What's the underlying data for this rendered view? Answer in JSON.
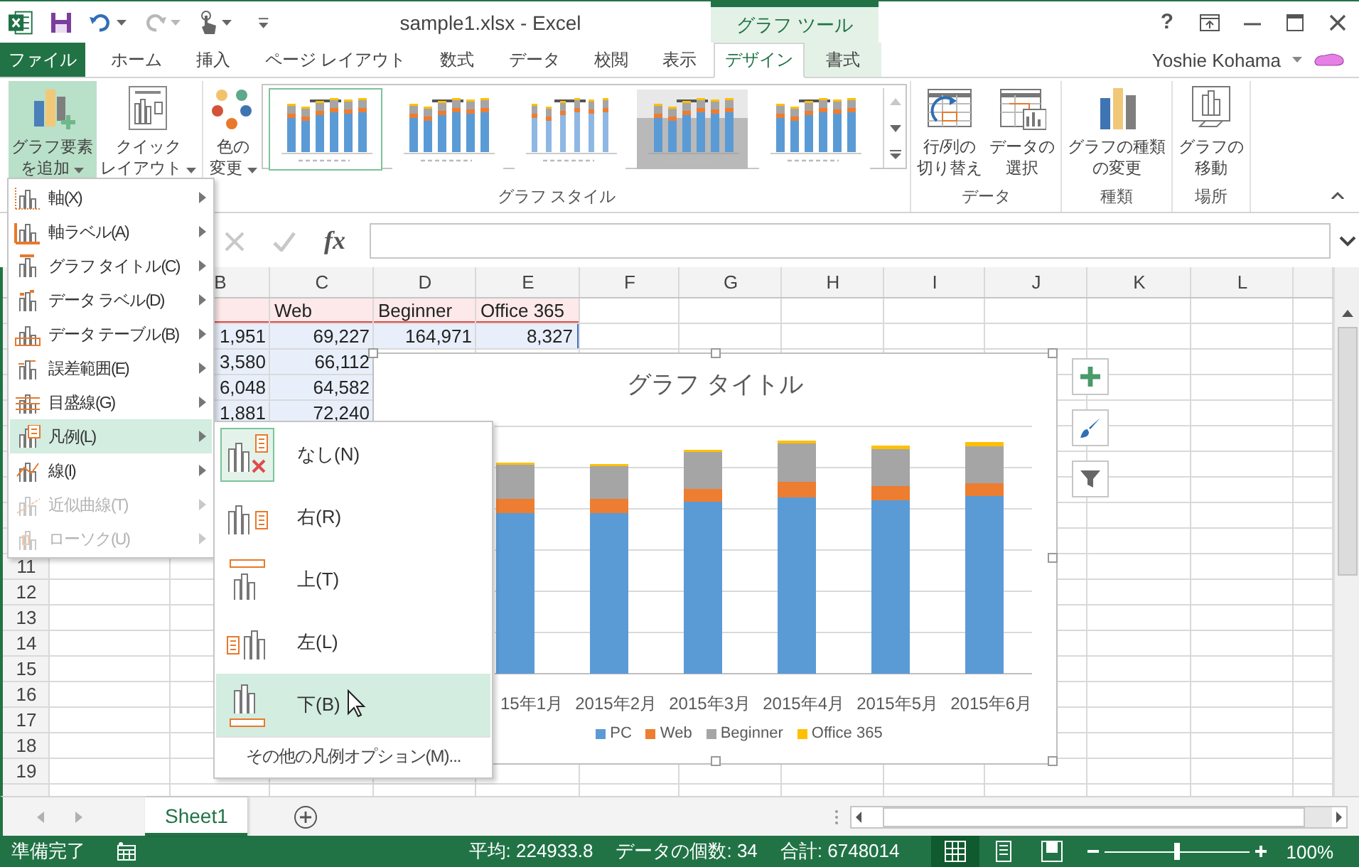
{
  "window": {
    "title": "sample1.xlsx - Excel",
    "contextual_group": "グラフ ツール",
    "help": "?",
    "user": "Yoshie Kohama"
  },
  "tabs": [
    {
      "label": "ファイル",
      "kind": "file",
      "selected": false
    },
    {
      "label": "ホーム",
      "kind": "normal",
      "selected": false
    },
    {
      "label": "挿入",
      "kind": "normal",
      "selected": false
    },
    {
      "label": "ページ レイアウト",
      "kind": "normal",
      "selected": false
    },
    {
      "label": "数式",
      "kind": "normal",
      "selected": false
    },
    {
      "label": "データ",
      "kind": "normal",
      "selected": false
    },
    {
      "label": "校閲",
      "kind": "normal",
      "selected": false
    },
    {
      "label": "表示",
      "kind": "normal",
      "selected": false
    },
    {
      "label": "デザイン",
      "kind": "contextual",
      "selected": true
    },
    {
      "label": "書式",
      "kind": "contextual",
      "selected": false
    }
  ],
  "ribbon": {
    "layout_buttons": [
      {
        "lines": [
          "グラフ要素",
          "を追加"
        ],
        "pressed": true
      },
      {
        "lines": [
          "クイック",
          "レイアウト"
        ],
        "pressed": false
      }
    ],
    "style_group": {
      "label": "グラフ スタイル",
      "color_button": {
        "lines": [
          "色の",
          "変更"
        ]
      },
      "styles": [
        {
          "selected": true
        },
        {
          "selected": false
        },
        {
          "selected": false
        },
        {
          "selected": false
        },
        {
          "selected": false
        }
      ]
    },
    "groups": [
      {
        "label": "データ",
        "buttons": [
          {
            "lines": [
              "行/列の",
              "切り替え"
            ]
          },
          {
            "lines": [
              "データの",
              "選択"
            ]
          }
        ]
      },
      {
        "label": "種類",
        "buttons": [
          {
            "lines": [
              "グラフの種類",
              "の変更"
            ]
          }
        ]
      },
      {
        "label": "場所",
        "buttons": [
          {
            "lines": [
              "グラフの",
              "移動"
            ]
          }
        ]
      }
    ]
  },
  "formula_bar": {
    "function_label": "fx"
  },
  "sheet": {
    "columns": [
      "B",
      "C",
      "D",
      "E",
      "F",
      "G",
      "H",
      "I",
      "J",
      "K",
      "L"
    ],
    "data_rows": [
      {
        "kind": "names",
        "cells": {
          "C": "Web",
          "D": "Beginner",
          "E": "Office 365"
        }
      },
      {
        "kind": "values",
        "cells": {
          "B": "1,951",
          "C": "69,227",
          "D": "164,971",
          "E": "8,327"
        }
      },
      {
        "kind": "values",
        "cells": {
          "B": "3,580",
          "C": "66,112"
        }
      },
      {
        "kind": "values",
        "cells": {
          "B": "6,048",
          "C": "64,582"
        }
      },
      {
        "kind": "values",
        "cells": {
          "B": "1,881",
          "C": "72,240"
        }
      }
    ],
    "row_numbers": [
      "11",
      "12",
      "13",
      "14",
      "15",
      "16",
      "17",
      "18",
      "19"
    ]
  },
  "chart": {
    "title": "グラフ タイトル",
    "x_labels": [
      "15年1月",
      "2015年2月",
      "2015年3月",
      "2015年4月",
      "2015年5月",
      "2015年6月"
    ],
    "legend": [
      {
        "name": "PC",
        "color": "#5b9bd5"
      },
      {
        "name": "Web",
        "color": "#ed7d31"
      },
      {
        "name": "Beginner",
        "color": "#a5a5a5"
      },
      {
        "name": "Office 365",
        "color": "#ffc000"
      }
    ]
  },
  "element_menu": [
    {
      "label": "軸(X)",
      "highlighted": false,
      "disabled": false
    },
    {
      "label": "軸ラベル(A)",
      "highlighted": false,
      "disabled": false
    },
    {
      "label": "グラフ タイトル(C)",
      "highlighted": false,
      "disabled": false
    },
    {
      "label": "データ ラベル(D)",
      "highlighted": false,
      "disabled": false
    },
    {
      "label": "データ テーブル(B)",
      "highlighted": false,
      "disabled": false
    },
    {
      "label": "誤差範囲(E)",
      "highlighted": false,
      "disabled": false
    },
    {
      "label": "目盛線(G)",
      "highlighted": false,
      "disabled": false
    },
    {
      "label": "凡例(L)",
      "highlighted": true,
      "disabled": false
    },
    {
      "label": "線(I)",
      "highlighted": false,
      "disabled": false
    },
    {
      "label": "近似曲線(T)",
      "highlighted": false,
      "disabled": true
    },
    {
      "label": "ローソク(U)",
      "highlighted": false,
      "disabled": true
    }
  ],
  "legend_menu": {
    "items": [
      {
        "label": "なし(N)",
        "selected": true,
        "highlighted": false
      },
      {
        "label": "右(R)",
        "selected": false,
        "highlighted": false
      },
      {
        "label": "上(T)",
        "selected": false,
        "highlighted": false
      },
      {
        "label": "左(L)",
        "selected": false,
        "highlighted": false
      },
      {
        "label": "下(B)",
        "selected": false,
        "highlighted": true
      }
    ],
    "more": "その他の凡例オプション(M)..."
  },
  "sheet_tabs": [
    {
      "label": "Sheet1",
      "selected": true
    }
  ],
  "status_bar": {
    "ready": "準備完了",
    "average": "平均: 224933.8",
    "count": "データの個数: 34",
    "sum": "合計: 6748014",
    "views": [
      {
        "selected": true
      },
      {
        "selected": false
      },
      {
        "selected": false
      }
    ],
    "zoom": {
      "level": 0.5,
      "reading": "100%"
    }
  }
}
